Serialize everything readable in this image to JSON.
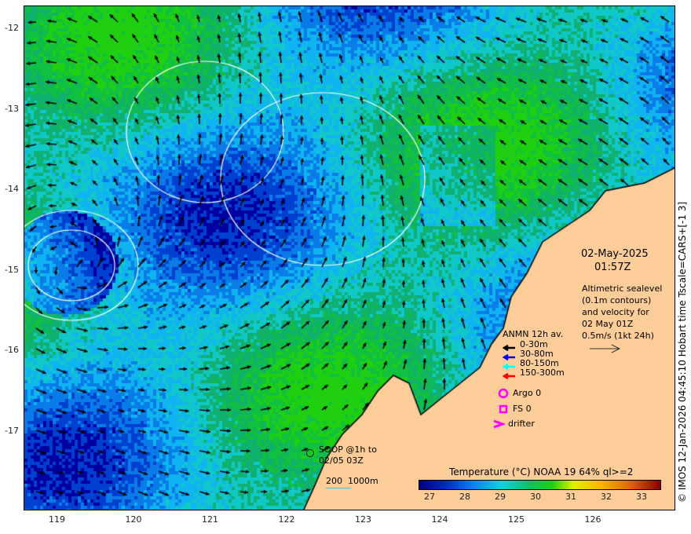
{
  "map": {
    "lon_range": [
      118.59,
      127.1
    ],
    "lat_range": [
      -17.99,
      -11.73
    ]
  },
  "y_ticks": [
    "-12",
    "-13",
    "-14",
    "-15",
    "-16",
    "-17"
  ],
  "x_ticks": [
    "119",
    "120",
    "121",
    "122",
    "123",
    "124",
    "125",
    "126"
  ],
  "timestamp": {
    "date": "02-May-2025",
    "time": "01:57Z"
  },
  "altimetry": [
    "Altimetric sealevel",
    "(0.1m contours)",
    "and velocity for",
    "02 May 01Z",
    "0.5m/s (1kt 24h)"
  ],
  "anmn": {
    "title": "ANMN 12h av.",
    "items": [
      {
        "label": "0-30m",
        "color": "#000000"
      },
      {
        "label": "30-80m",
        "color": "#0000ff"
      },
      {
        "label": "80-150m",
        "color": "#00ffff"
      },
      {
        "label": "150-300m",
        "color": "#ff0000"
      }
    ]
  },
  "argo": "Argo 0",
  "fs": "FS 0",
  "drifter": "drifter",
  "soop": [
    "SOOP @1h to",
    "02/05 03Z"
  ],
  "bathy": "200  1000m",
  "colorbar": {
    "title": "Temperature (°C) NOAA 19 64% ql>=2",
    "ticks": [
      "27",
      "28",
      "29",
      "30",
      "31",
      "32",
      "33"
    ],
    "range": [
      26.7,
      33.55
    ]
  },
  "side_text": "© IMOS 12-Jan-2026 04:45:10 Hobart time Tscale=CARS+[-1 3]",
  "colors": {
    "land": "#fccc99",
    "magenta": "#ff00ff"
  }
}
